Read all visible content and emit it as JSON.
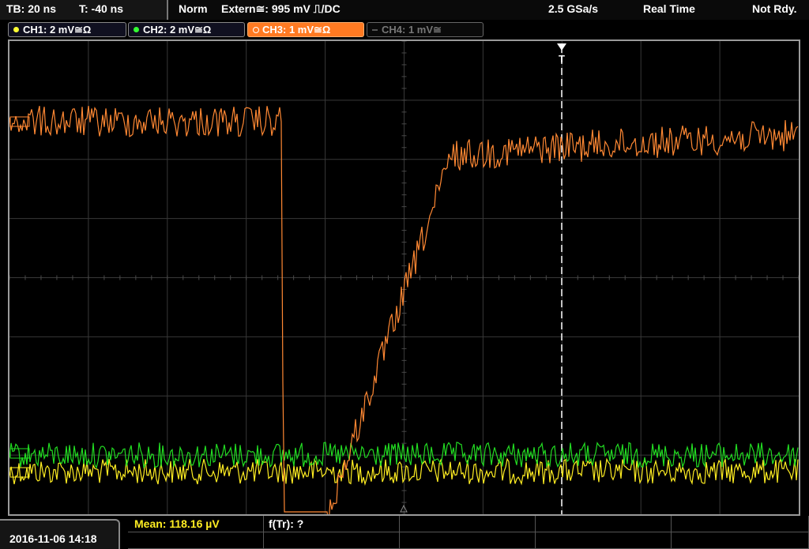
{
  "status_bar": {
    "timebase": "TB: 20 ns",
    "trigger_time": "T: -40 ns",
    "trigger_mode": "Norm",
    "trigger_source": "Extern≅: 995 mV ⎍/DC",
    "sample_rate": "2.5 GSa/s",
    "acq_mode": "Real Time",
    "status": "Not Rdy."
  },
  "channels": [
    {
      "label": "CH1: 2 mV≅Ω",
      "color": "#ffff33",
      "active": false
    },
    {
      "label": "CH2: 2 mV≅Ω",
      "color": "#33ff33",
      "active": false
    },
    {
      "label": "CH3: 1 mV≅Ω",
      "color": "#ff8833",
      "active": true
    },
    {
      "label": "CH4: 1 mV≅",
      "color": "#666666",
      "active": false
    }
  ],
  "trigger_marker": "T",
  "measurements": {
    "mean": "Mean: 118.16 µV",
    "rise_freq": "f(Tr): ?"
  },
  "datetime": "2016-11-06 14:18",
  "colors": {
    "ch1": "#ffee22",
    "ch2": "#22dd22",
    "ch3": "#ff8833",
    "grid": "#3a3a3a",
    "frame": "#9a9a9a"
  }
}
